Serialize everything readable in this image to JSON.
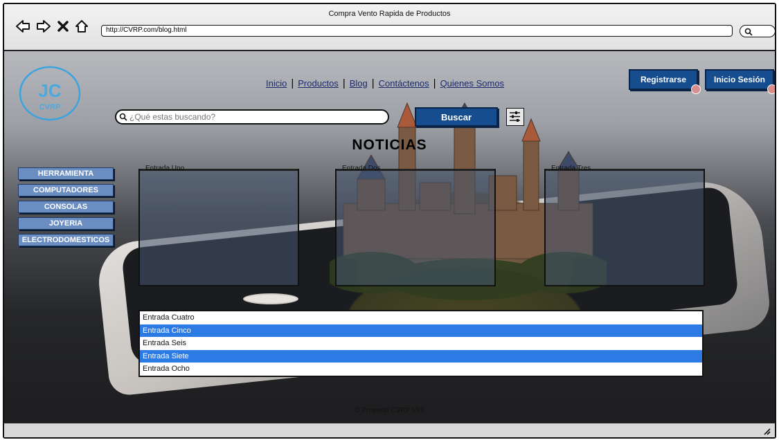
{
  "window": {
    "title": "Compra Vento Rapida de Productos",
    "url": "http://CVRP.com/blog.html"
  },
  "logo": {
    "mark": "JC",
    "text": "CVRP"
  },
  "nav": {
    "items": [
      "Inicio",
      "Productos",
      "Blog",
      "Contáctenos",
      "Quienes Somos"
    ],
    "separator": "|"
  },
  "auth": {
    "register_label": "Registrarse",
    "login_label": "Inicio Sesión"
  },
  "search": {
    "placeholder": "¿Qué estas buscando?",
    "button_label": "Buscar"
  },
  "page_title": "NOTICIAS",
  "categories": [
    "HERRAMIENTA",
    "COMPUTADORES",
    "CONSOLAS",
    "JOYERIA",
    "ELECTRODOMESTICOS"
  ],
  "panels": [
    "Entrada Uno",
    "Entrada Dos",
    "Entrada Tres"
  ],
  "entries": [
    {
      "label": "Entrada  Cuatro",
      "selected": false
    },
    {
      "label": "Entrada  Cinco",
      "selected": true
    },
    {
      "label": "Entrada  Seis",
      "selected": false
    },
    {
      "label": "Entrada  Siete",
      "selected": true
    },
    {
      "label": "Entrada  Ocho",
      "selected": false
    }
  ],
  "footer": "© Proyecto CVRP V10",
  "colors": {
    "accent": "#154d8f",
    "category": "#6b8ec2",
    "selection": "#2c7be5",
    "link": "#1a2a6c"
  }
}
